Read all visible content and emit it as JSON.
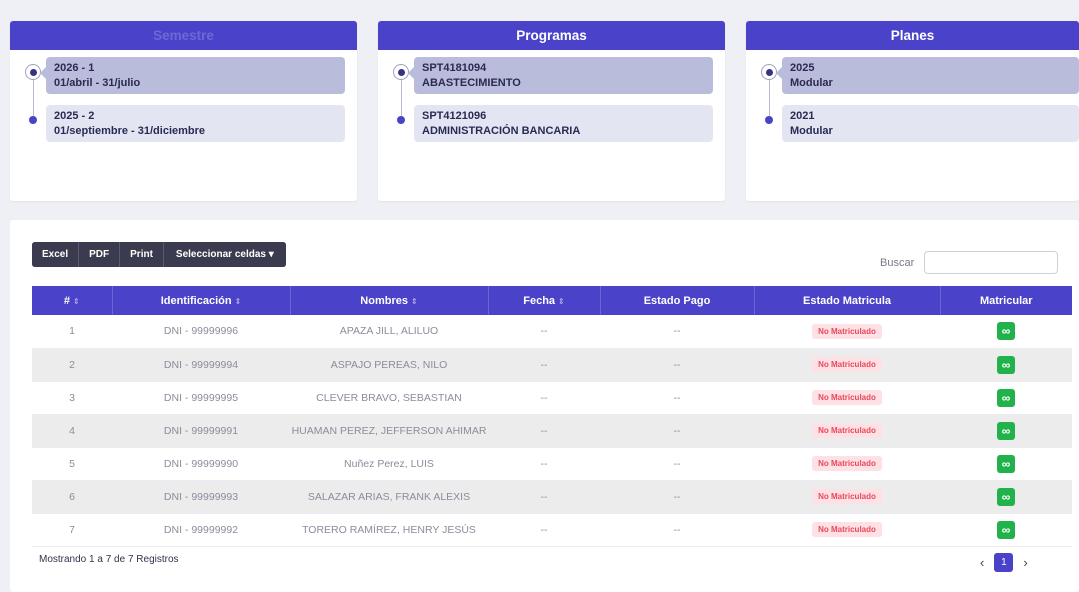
{
  "panels": {
    "semestre": {
      "title": "Semestre",
      "items": [
        {
          "line1": "2026 - 1",
          "line2": "01/abril - 31/julio"
        },
        {
          "line1": "2025 - 2",
          "line2": "01/septiembre - 31/diciembre"
        }
      ]
    },
    "programas": {
      "title": "Programas",
      "items": [
        {
          "line1": "SPT4181094",
          "line2": "ABASTECIMIENTO"
        },
        {
          "line1": "SPT4121096",
          "line2": "ADMINISTRACIÓN BANCARIA"
        }
      ]
    },
    "planes": {
      "title": "Planes",
      "items": [
        {
          "line1": "2025",
          "line2": "Modular"
        },
        {
          "line1": "2021",
          "line2": "Modular"
        }
      ]
    }
  },
  "toolbar": {
    "excel": "Excel",
    "pdf": "PDF",
    "print": "Print",
    "select_cells": "Seleccionar celdas ▾"
  },
  "search": {
    "label": "Buscar",
    "value": ""
  },
  "table": {
    "headers": [
      "#",
      "Identificación",
      "Nombres",
      "Fecha",
      "Estado Pago",
      "Estado Matricula",
      "Matricular"
    ],
    "sort_glyph": "⇕",
    "rows": [
      {
        "n": "1",
        "id": "DNI - 99999996",
        "name": "APAZA JILL, ALILUO",
        "fecha": "--",
        "pago": "--",
        "estado": "No Matriculado"
      },
      {
        "n": "2",
        "id": "DNI - 99999994",
        "name": "ASPAJO PEREAS, NILO",
        "fecha": "--",
        "pago": "--",
        "estado": "No Matriculado"
      },
      {
        "n": "3",
        "id": "DNI - 99999995",
        "name": "CLEVER BRAVO, SEBASTIAN",
        "fecha": "--",
        "pago": "--",
        "estado": "No Matriculado"
      },
      {
        "n": "4",
        "id": "DNI - 99999991",
        "name": "HUAMAN PEREZ, JEFFERSON AHIMAR",
        "fecha": "--",
        "pago": "--",
        "estado": "No Matriculado"
      },
      {
        "n": "5",
        "id": "DNI - 99999990",
        "name": "Nuñez Perez, LUIS",
        "fecha": "--",
        "pago": "--",
        "estado": "No Matriculado"
      },
      {
        "n": "6",
        "id": "DNI - 99999993",
        "name": "SALAZAR ARIAS, FRANK ALEXIS",
        "fecha": "--",
        "pago": "--",
        "estado": "No Matriculado"
      },
      {
        "n": "7",
        "id": "DNI - 99999992",
        "name": "TORERO RAMÍREZ, HENRY JESÚS",
        "fecha": "--",
        "pago": "--",
        "estado": "No Matriculado"
      }
    ]
  },
  "footer": {
    "info": "Mostrando 1 a 7 de 7 Registros",
    "prev": "‹",
    "page": "1",
    "next": "›"
  },
  "colors": {
    "primary": "#4a42c8",
    "success": "#22b24c",
    "danger": "#e8485c"
  }
}
